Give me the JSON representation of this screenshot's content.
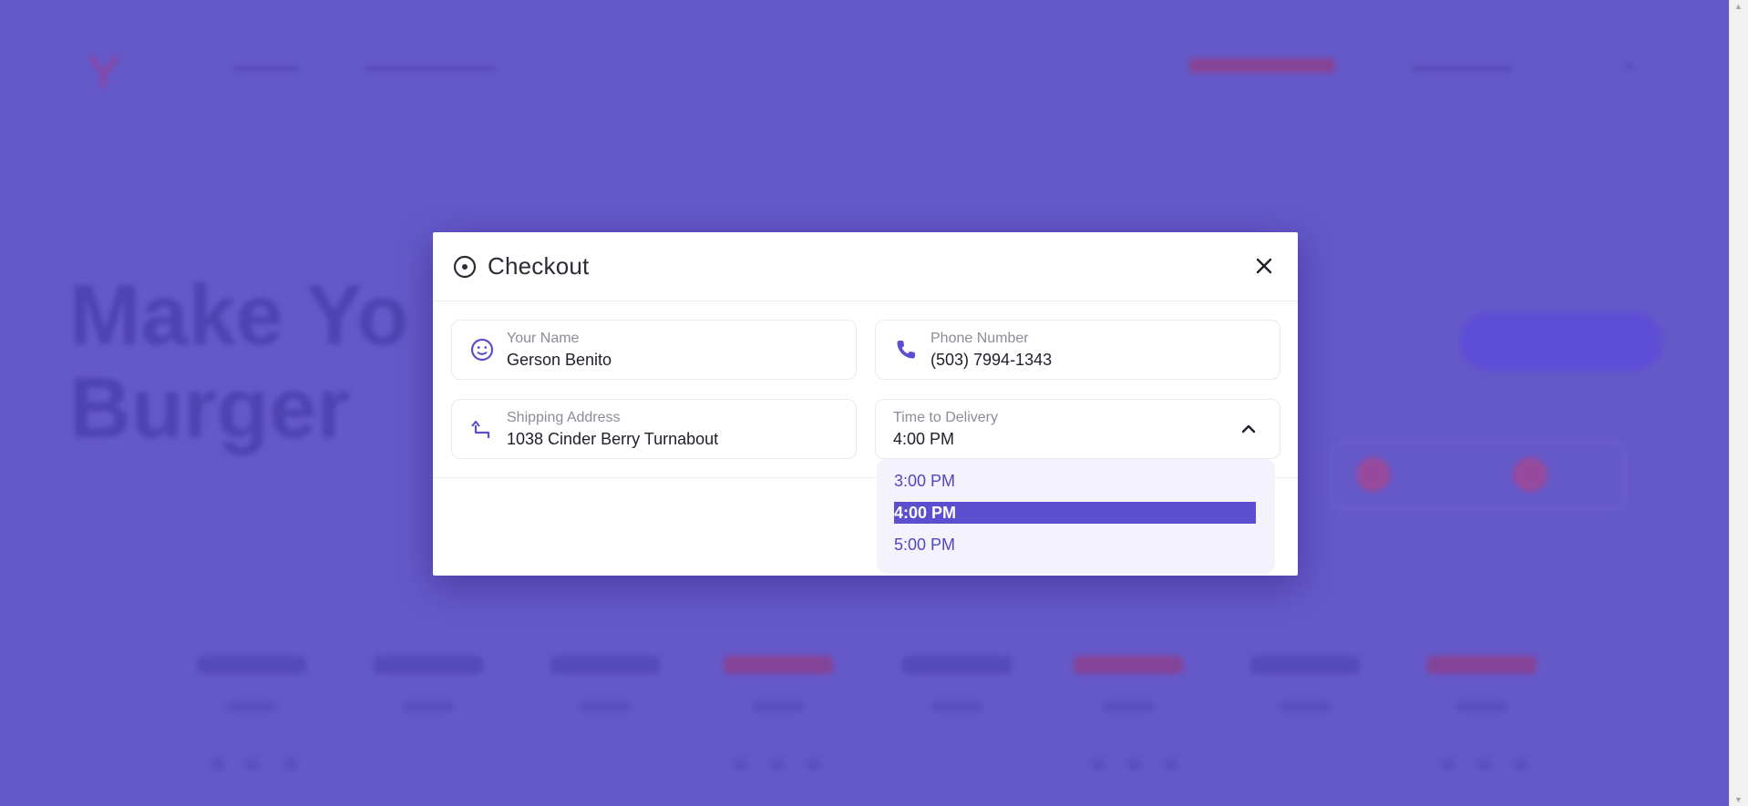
{
  "modal": {
    "title": "Checkout",
    "fields": {
      "name": {
        "label": "Your Name",
        "value": "Gerson Benito",
        "icon": "smiley-face-icon"
      },
      "phone": {
        "label": "Phone Number",
        "value": "(503) 7994-1343",
        "icon": "phone-icon"
      },
      "address": {
        "label": "Shipping Address",
        "value": "1038 Cinder Berry Turnabout",
        "icon": "turn-up-arrow-icon"
      },
      "time": {
        "label": "Time to Delivery",
        "value": "4:00 PM",
        "icon": "chevron-up-icon"
      }
    },
    "dropdown": {
      "options": [
        "3:00 PM",
        "4:00 PM",
        "5:00 PM"
      ],
      "selected": "4:00 PM"
    }
  },
  "background": {
    "hero": [
      "Make Yo",
      "Burger"
    ]
  },
  "colors": {
    "accent": "#5b4fcf",
    "overlay": "#6558c9",
    "option_text": "#5346c4",
    "dropdown_bg": "#f3f2fd"
  }
}
